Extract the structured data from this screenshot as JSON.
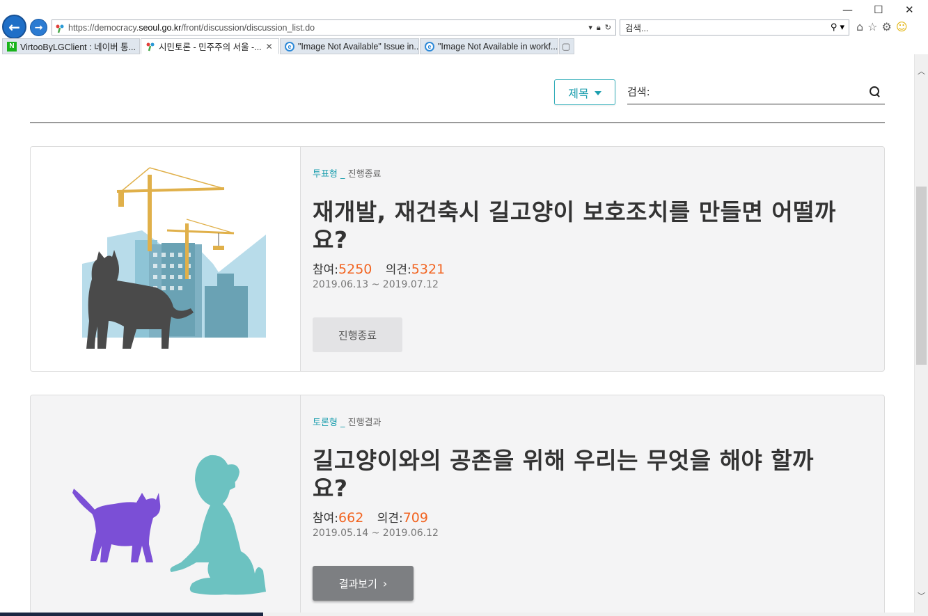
{
  "browser": {
    "url_prefix": "https://democracy.",
    "url_domain": "seoul.go.kr",
    "url_path": "/front/discussion/discussion_list.do",
    "search_placeholder": "검색...",
    "tabs": [
      {
        "label": "VirtooByLGClient : 네이버 통...",
        "icon": "naver-icon"
      },
      {
        "label": "시민토론 - 민주주의 서울 -...",
        "icon": "seoul-icon",
        "active": true,
        "close": "✕"
      },
      {
        "label": "\"Image Not Available\" Issue in...",
        "icon": "ie-icon"
      },
      {
        "label": "\"Image Not Available in workf...",
        "icon": "ie-icon"
      }
    ]
  },
  "search": {
    "filter_label": "제목",
    "label": "검색:",
    "value": ""
  },
  "discussions": [
    {
      "type": "투표형",
      "separator": "_",
      "status": "진행종료",
      "title": "재개발, 재건축시 길고양이 보호조치를 만들면 어떨까요?",
      "participation_label": "참여:",
      "participation": "5250",
      "opinion_label": "의견:",
      "opinion": "5321",
      "period": "2019.06.13 ~ 2019.07.12",
      "button_label": "진행종료"
    },
    {
      "type": "토론형",
      "separator": "_",
      "status": "진행결과",
      "title": "길고양이와의 공존을 위해 우리는 무엇을 해야 할까요?",
      "participation_label": "참여:",
      "participation": "662",
      "opinion_label": "의견:",
      "opinion": "709",
      "period": "2019.05.14 ~ 2019.06.12",
      "button_label": "결과보기"
    }
  ],
  "colors": {
    "accent": "#1b9eae",
    "number": "#f26522",
    "cat_dark": "#4a4a4a",
    "cat_purple": "#7b4fd6",
    "girl_teal": "#6cc2c1"
  }
}
